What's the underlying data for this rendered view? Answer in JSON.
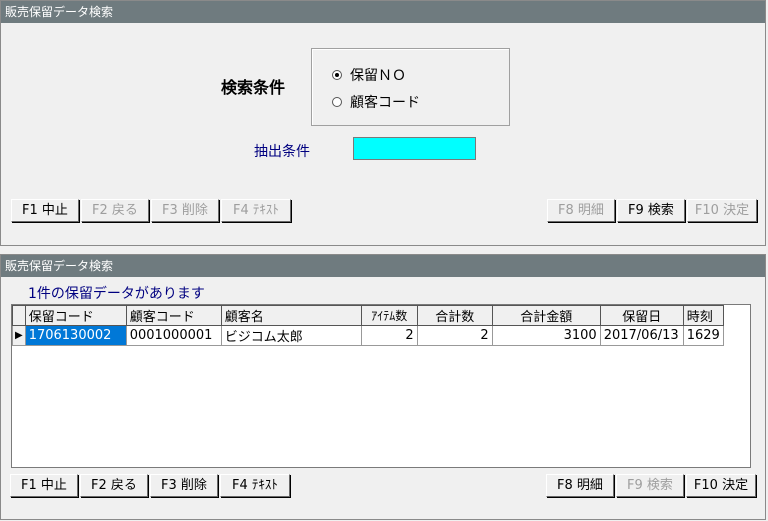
{
  "search_panel": {
    "title": "販売保留データ検索",
    "label": "検索条件",
    "radio_options": [
      "保留ＮＯ",
      "顧客コード"
    ],
    "extract_label": "抽出条件",
    "extract_value": "",
    "buttons": [
      "F1 中止",
      "F2 戻る",
      "F3 削除",
      "F4 ﾃｷｽﾄ",
      "F8 明細",
      "F9 検索",
      "F10 決定"
    ]
  },
  "result_panel": {
    "title": "販売保留データ検索",
    "count_message": "1件の保留データがあります",
    "columns": [
      "保留コード",
      "顧客コード",
      "顧客名",
      "ｱｲﾃﾑ数",
      "合計数",
      "合計金額",
      "保留日",
      "時刻"
    ],
    "rows": [
      [
        "1706130002",
        "0001000001",
        "ビジコム太郎",
        "2",
        "2",
        "3100",
        "2017/06/13",
        "1629"
      ]
    ],
    "buttons": [
      "F1 中止",
      "F2 戻る",
      "F3 削除",
      "F4 ﾃｷｽﾄ",
      "F8 明細",
      "F9 検索",
      "F10 決定"
    ]
  },
  "colors": {
    "titlebar": "#6f7b7f",
    "selection": "#0078d7",
    "input": "#00ffff",
    "label_blue": "#000080"
  }
}
